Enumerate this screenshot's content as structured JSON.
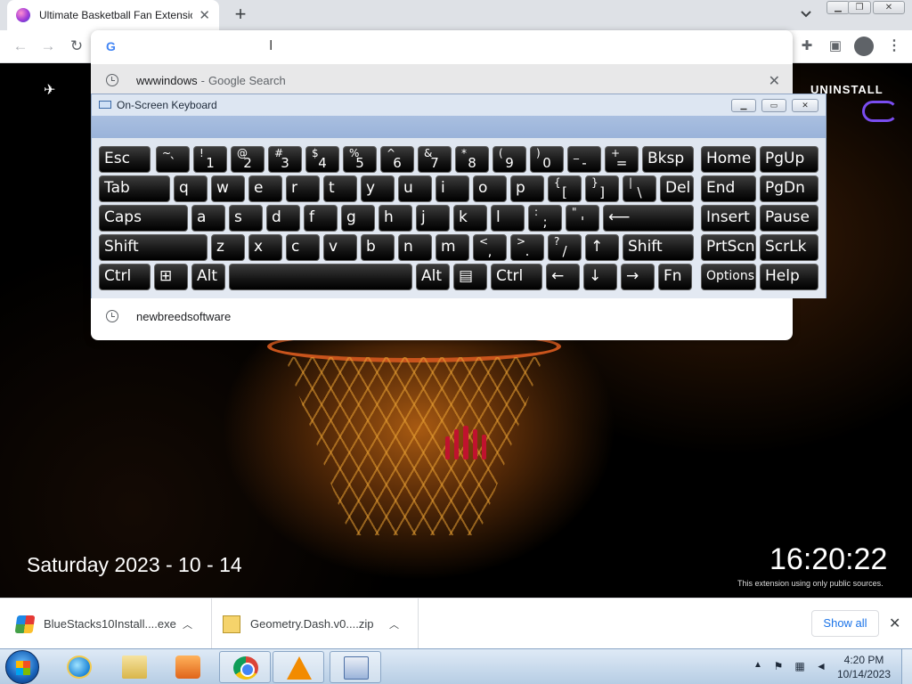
{
  "browser": {
    "tab_title": "Ultimate Basketball Fan Extension",
    "tab_close": "✕",
    "new_tab": "+",
    "omnibox_value": ""
  },
  "omnibox_suggestions": [
    {
      "text": "wwwindows",
      "separator": "-",
      "suffix": "Google Search",
      "removable": true
    },
    {
      "text": "newbreedsoftware",
      "separator": "",
      "suffix": "",
      "removable": false
    }
  ],
  "page": {
    "uninstall": "UNINSTALL",
    "date": "Saturday 2023 - 10 - 14",
    "time": "16:20:22",
    "footnote": "This extension using only public sources."
  },
  "osk": {
    "title": "On-Screen Keyboard",
    "rows": [
      [
        {
          "main": "Esc"
        },
        {
          "upper": "~",
          "lower": "`"
        },
        {
          "upper": "!",
          "lower": "1"
        },
        {
          "upper": "@",
          "lower": "2"
        },
        {
          "upper": "#",
          "lower": "3"
        },
        {
          "upper": "$",
          "lower": "4"
        },
        {
          "upper": "%",
          "lower": "5"
        },
        {
          "upper": "^",
          "lower": "6"
        },
        {
          "upper": "&",
          "lower": "7"
        },
        {
          "upper": "*",
          "lower": "8"
        },
        {
          "upper": "(",
          "lower": "9"
        },
        {
          "upper": ")",
          "lower": "0"
        },
        {
          "upper": "_",
          "lower": "-"
        },
        {
          "upper": "+",
          "lower": "="
        },
        {
          "main": "Bksp"
        },
        {
          "main": "Home"
        },
        {
          "main": "PgUp"
        }
      ],
      [
        {
          "main": "Tab"
        },
        {
          "main": "q"
        },
        {
          "main": "w"
        },
        {
          "main": "e"
        },
        {
          "main": "r"
        },
        {
          "main": "t"
        },
        {
          "main": "y"
        },
        {
          "main": "u"
        },
        {
          "main": "i"
        },
        {
          "main": "o"
        },
        {
          "main": "p"
        },
        {
          "upper": "{",
          "lower": "["
        },
        {
          "upper": "}",
          "lower": "]"
        },
        {
          "upper": "|",
          "lower": "\\"
        },
        {
          "main": "Del"
        },
        {
          "main": "End"
        },
        {
          "main": "PgDn"
        }
      ],
      [
        {
          "main": "Caps"
        },
        {
          "main": "a"
        },
        {
          "main": "s"
        },
        {
          "main": "d"
        },
        {
          "main": "f"
        },
        {
          "main": "g"
        },
        {
          "main": "h"
        },
        {
          "main": "j"
        },
        {
          "main": "k"
        },
        {
          "main": "l"
        },
        {
          "upper": ":",
          "lower": ";"
        },
        {
          "upper": "\"",
          "lower": "'"
        },
        {
          "main": "⟵"
        },
        {
          "main": "Insert"
        },
        {
          "main": "Pause"
        }
      ],
      [
        {
          "main": "Shift"
        },
        {
          "main": "z"
        },
        {
          "main": "x"
        },
        {
          "main": "c"
        },
        {
          "main": "v"
        },
        {
          "main": "b"
        },
        {
          "main": "n"
        },
        {
          "main": "m"
        },
        {
          "upper": "<",
          "lower": ","
        },
        {
          "upper": ">",
          "lower": "."
        },
        {
          "upper": "?",
          "lower": "/"
        },
        {
          "main": "↑"
        },
        {
          "main": "Shift"
        },
        {
          "main": "PrtScn"
        },
        {
          "main": "ScrLk"
        }
      ],
      [
        {
          "main": "Ctrl"
        },
        {
          "main": "⊞"
        },
        {
          "main": "Alt"
        },
        {
          "main": ""
        },
        {
          "main": "Alt"
        },
        {
          "main": "▤"
        },
        {
          "main": "Ctrl"
        },
        {
          "main": "←"
        },
        {
          "main": "↓"
        },
        {
          "main": "→"
        },
        {
          "main": "Fn"
        },
        {
          "main": "Options"
        },
        {
          "main": "Help"
        }
      ]
    ]
  },
  "downloads": [
    {
      "name": "BlueStacks10Install....exe",
      "icon": "bluestacks-icon"
    },
    {
      "name": "Geometry.Dash.v0....zip",
      "icon": "zip-icon"
    }
  ],
  "downloads_show_all": "Show all",
  "taskbar": {
    "clock_time": "4:20 PM",
    "clock_date": "10/14/2023"
  }
}
